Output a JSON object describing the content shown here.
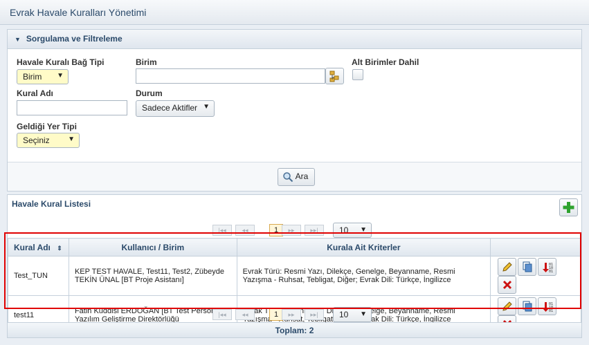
{
  "window": {
    "title": "Evrak Havale Kuralları Yönetimi"
  },
  "filter": {
    "title": "Sorgulama ve Filtreleme",
    "bag_tipi_label": "Havale Kuralı Bağ Tipi",
    "bag_tipi_value": "Birim",
    "birim_label": "Birim",
    "alt_birimler_label": "Alt Birimler Dahil",
    "kural_adi_label": "Kural Adı",
    "durum_label": "Durum",
    "durum_value": "Sadece Aktifler",
    "geldigi_yer_label": "Geldiği Yer Tipi",
    "geldigi_yer_value": "Seçiniz",
    "search_label": "Ara"
  },
  "list": {
    "title": "Havale Kural Listesi",
    "pager": {
      "page": "1",
      "page_size": "10"
    },
    "columns": [
      "Kural Adı",
      "Kullanıcı / Birim",
      "Kurala Ait Kriterler"
    ],
    "rows": [
      {
        "name": "Test_TUN",
        "user": "KEP TEST HAVALE, Test11, Test2, Zübeyde TEKİN ÜNAL [BT Proje Asistanı]",
        "criteria": "Evrak Türü: Resmi Yazı, Dilekçe, Genelge, Beyanname, Resmi Yazışma - Ruhsat, Tebligat, Diğer; Evrak Dili: Türkçe, İngilizce"
      },
      {
        "name": "test11",
        "user": "Fatih Kuddisi ERDOĞAN [BT Test Personeli], Yazılım Geliştirme Direktörlüğü",
        "criteria": "Evrak Türü: Resmi Yazı, Dilekçe, Genelge, Beyanname, Resmi Yazışma - Ruhsat, Tebligat, Diğer; Evrak Dili: Türkçe, İngilizce"
      }
    ],
    "total": "Toplam: 2"
  },
  "icons": {
    "toggle": "triangle-down-icon",
    "tree": "tree-selector-icon",
    "search": "magnifier-icon",
    "add": "plus-icon",
    "sort": "sort-icon",
    "row_actions": [
      "pencil-icon",
      "copy-icon",
      "binary-export-icon",
      "delete-x-icon"
    ]
  },
  "colors": {
    "highlight": "#e00000",
    "add": "#2ea22e",
    "delete": "#cc1111",
    "selected_field": "#fffbc8"
  }
}
